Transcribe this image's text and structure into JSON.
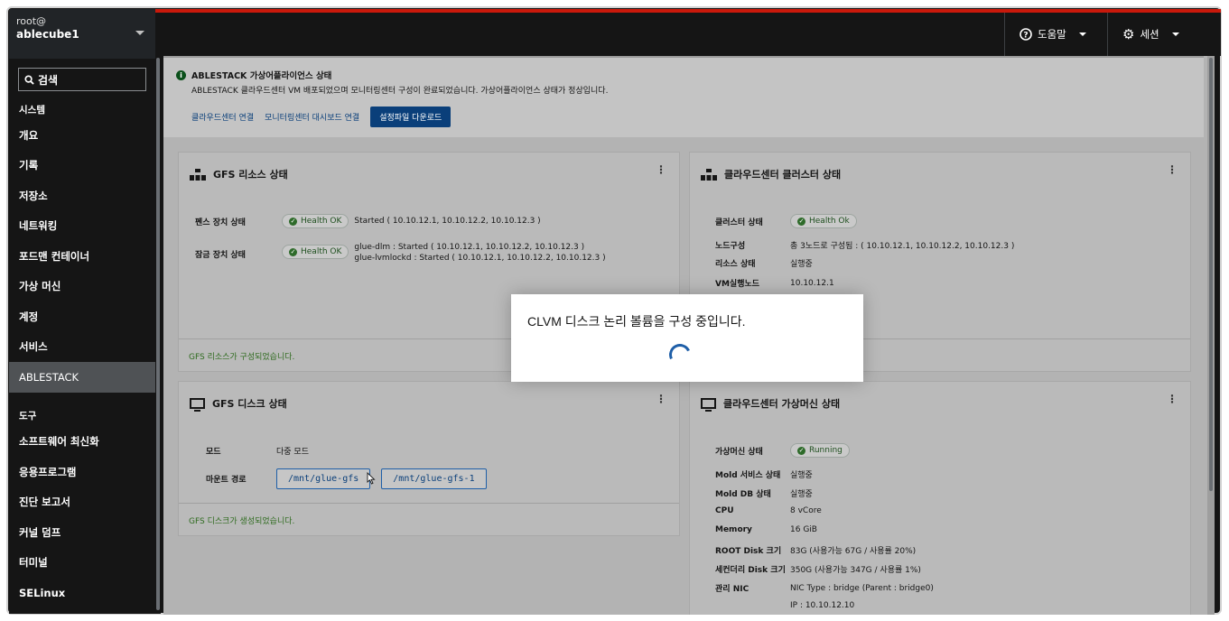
{
  "sidebar": {
    "host_user": "root@",
    "host_name": "ablecube1",
    "search_label": "검색",
    "section_system": "시스템",
    "items_system": [
      "개요",
      "기록",
      "저장소",
      "네트워킹",
      "포드맨 컨테이너",
      "가상 머신",
      "계정",
      "서비스",
      "ABLESTACK"
    ],
    "section_tools": "도구",
    "items_tools": [
      "소프트웨어 최신화",
      "응용프로그램",
      "진단 보고서",
      "커널 덤프",
      "터미널",
      "SELinux"
    ]
  },
  "topbar": {
    "help_label": "도움말",
    "session_label": "세션"
  },
  "alert": {
    "title": "ABLESTACK 가상어플라이언스 상태",
    "description": "ABLESTACK 클라우드센터 VM 배포되었으며 모니터링센터 구성이 완료되었습니다. 가상어플라이언스 상태가 정상입니다.",
    "link_cloud": "클라우드센터 연결",
    "link_monitor": "모니터링센터 대시보드 연결",
    "button_download": "설정파일 다운로드"
  },
  "gfs_resource": {
    "title": "GFS 리소스 상태",
    "fence_label": "펜스 장치 상태",
    "fence_badge": "Health OK",
    "fence_value": "Started ( 10.10.12.1, 10.10.12.2, 10.10.12.3 )",
    "lock_label": "잠금 장치 상태",
    "lock_badge": "Health OK",
    "lock_value_1": "glue-dlm : Started ( 10.10.12.1, 10.10.12.2, 10.10.12.3 )",
    "lock_value_2": "glue-lvmlockd : Started ( 10.10.12.1, 10.10.12.2, 10.10.12.3 )",
    "footer": "GFS 리소스가 구성되었습니다."
  },
  "cloud_cluster": {
    "title": "클라우드센터 클러스터 상태",
    "cluster_label": "클러스터 상태",
    "cluster_badge": "Health Ok",
    "node_label": "노드구성",
    "node_value": "총 3노드로 구성됨 : ( 10.10.12.1, 10.10.12.2, 10.10.12.3 )",
    "resource_label": "리소스 상태",
    "resource_value": "실행중",
    "vmnode_label": "VM실행노드",
    "vmnode_value": "10.10.12.1"
  },
  "gfs_disk": {
    "title": "GFS 디스크 상태",
    "mode_label": "모드",
    "mode_value": "다중 모드",
    "mount_label": "마운트 경로",
    "mount_1": "/mnt/glue-gfs",
    "mount_2": "/mnt/glue-gfs-1",
    "footer": "GFS 디스크가 생성되었습니다."
  },
  "cloud_vm": {
    "title": "클라우드센터 가상머신 상태",
    "vm_label": "가상머신 상태",
    "vm_badge": "Running",
    "rows": [
      {
        "label": "Mold 서비스 상태",
        "value": "실행중"
      },
      {
        "label": "Mold DB 상태",
        "value": "실행중"
      },
      {
        "label": "CPU",
        "value": "8 vCore"
      },
      {
        "label": "Memory",
        "value": "16 GiB"
      },
      {
        "label": "ROOT Disk 크기",
        "value": "83G (사용가능 67G / 사용률 20%)"
      },
      {
        "label": "세컨더리 Disk 크기",
        "value": "350G (사용가능 347G / 사용률 1%)"
      },
      {
        "label": "관리 NIC",
        "value": "NIC Type : bridge (Parent : bridge0)"
      },
      {
        "label": "",
        "value": "IP : 10.10.12.10"
      }
    ]
  },
  "modal": {
    "message": "CLVM 디스크 논리 볼륨을 구성 중입니다."
  }
}
